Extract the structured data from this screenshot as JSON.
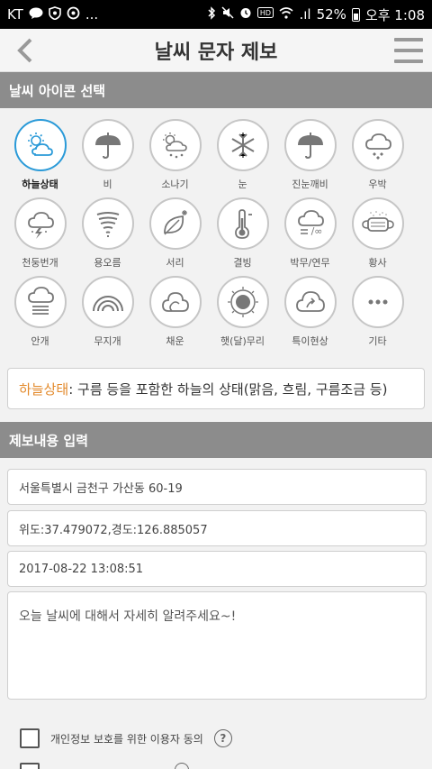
{
  "status_bar": {
    "carrier": "KT",
    "more": "...",
    "battery": "52%",
    "time": "오후 1:08",
    "signal": ".ıl"
  },
  "appbar": {
    "title": "날씨 문자 제보"
  },
  "icon_section": {
    "header": "날씨 아이콘 선택",
    "icons": [
      {
        "label": "하늘상태",
        "icon": "partly-cloudy-icon",
        "selected": true
      },
      {
        "label": "비",
        "icon": "rain-umbrella-icon"
      },
      {
        "label": "소나기",
        "icon": "shower-icon"
      },
      {
        "label": "눈",
        "icon": "snowflake-icon"
      },
      {
        "label": "진눈깨비",
        "icon": "sleet-icon"
      },
      {
        "label": "우박",
        "icon": "hail-icon"
      },
      {
        "label": "천둥번개",
        "icon": "thunder-icon"
      },
      {
        "label": "용오름",
        "icon": "tornado-icon"
      },
      {
        "label": "서리",
        "icon": "frost-leaf-icon"
      },
      {
        "label": "결빙",
        "icon": "thermometer-icon"
      },
      {
        "label": "박무/연무",
        "icon": "mist-icon"
      },
      {
        "label": "황사",
        "icon": "mask-icon"
      },
      {
        "label": "안개",
        "icon": "fog-icon"
      },
      {
        "label": "무지개",
        "icon": "rainbow-icon"
      },
      {
        "label": "채운",
        "icon": "colored-cloud-icon"
      },
      {
        "label": "햇(달)무리",
        "icon": "halo-icon"
      },
      {
        "label": "특이현상",
        "icon": "unusual-cloud-icon"
      },
      {
        "label": "기타",
        "icon": "more-dots-icon"
      }
    ],
    "description_term": "하늘상태",
    "description_text": " : 구름 등을 포함한 하늘의 상태(맑음, 흐림, 구름조금 등)"
  },
  "report_section": {
    "header": "제보내용 입력",
    "address": "서울특별시 금천구 가산동 60-19",
    "coords": "위도:37.479072,경도:126.885057",
    "datetime": "2017-08-22 13:08:51",
    "content_placeholder": "오늘 날씨에 대해서 자세히 알려주세요~!",
    "consent_label": "개인정보 보호를 위한 이용자 동의",
    "help_symbol": "?"
  },
  "colors": {
    "accent": "#2a9ad8",
    "highlight": "#e38a2c",
    "section_bg": "#8c8c8c"
  }
}
